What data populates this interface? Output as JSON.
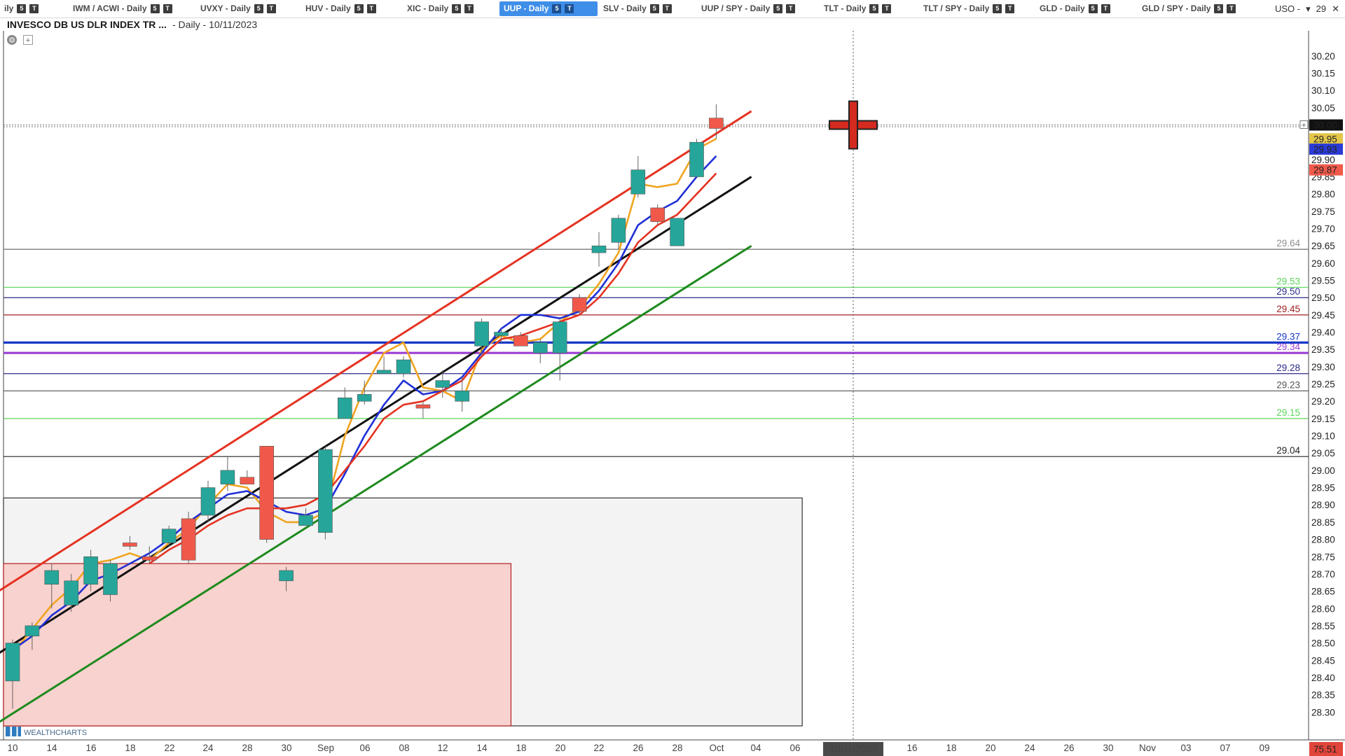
{
  "tabs": [
    {
      "label": "ily",
      "badges": [
        "5",
        "T"
      ],
      "active": false
    },
    {
      "label": "IWM / ACWI - Daily",
      "badges": [
        "5",
        "T"
      ],
      "active": false
    },
    {
      "label": "UVXY - Daily",
      "badges": [
        "5",
        "T"
      ],
      "active": false
    },
    {
      "label": "HUV - Daily",
      "badges": [
        "5",
        "T"
      ],
      "active": false
    },
    {
      "label": "XIC - Daily",
      "badges": [
        "5",
        "T"
      ],
      "active": false
    },
    {
      "label": "UUP - Daily",
      "badges": [
        "5",
        "T"
      ],
      "active": true
    },
    {
      "label": "SLV - Daily",
      "badges": [
        "5",
        "T"
      ],
      "active": false
    },
    {
      "label": "UUP / SPY - Daily",
      "badges": [
        "5",
        "T"
      ],
      "active": false
    },
    {
      "label": "TLT - Daily",
      "badges": [
        "5",
        "T"
      ],
      "active": false
    },
    {
      "label": "TLT / SPY - Daily",
      "badges": [
        "5",
        "T"
      ],
      "active": false
    },
    {
      "label": "GLD - Daily",
      "badges": [
        "5",
        "T"
      ],
      "active": false
    },
    {
      "label": "GLD / SPY - Daily",
      "badges": [
        "5",
        "T"
      ],
      "active": false
    }
  ],
  "tab_overflow": {
    "label": "USO -",
    "arrow": "▾",
    "count": "29",
    "close": "✕"
  },
  "header": {
    "title": "INVESCO DB US DLR INDEX TR ...",
    "subtitle": "- Daily - 10/11/2023"
  },
  "controls": {
    "settings_icon": "gear-icon",
    "add_icon": "plus-icon",
    "add_glyph": "+",
    "settings_glyph": "⚙"
  },
  "logo": {
    "text": "WEALTHCHARTS"
  },
  "colors": {
    "bull": "#26a69a",
    "bear": "#f0594a",
    "channel_upper": "#e53322",
    "channel_mid": "#111111",
    "channel_lower": "#1e8a1e",
    "ma_orange": "#f0a420",
    "ma_blue": "#1f2fd6",
    "ma_red": "#e53322"
  },
  "chart_data": {
    "type": "candlestick",
    "y_range": [
      28.26,
      30.22
    ],
    "y_ticks": [
      "30.20",
      "30.15",
      "30.10",
      "30.05",
      "29.90",
      "29.85",
      "29.80",
      "29.75",
      "29.70",
      "29.65",
      "29.60",
      "29.55",
      "29.50",
      "29.45",
      "29.40",
      "29.35",
      "29.30",
      "29.25",
      "29.20",
      "29.15",
      "29.10",
      "29.05",
      "29.00",
      "28.95",
      "28.90",
      "28.85",
      "28.80",
      "28.75",
      "28.70",
      "28.65",
      "28.60",
      "28.55",
      "28.50",
      "28.45",
      "28.40",
      "28.35",
      "28.30"
    ],
    "x_ticks": [
      "10",
      "14",
      "16",
      "18",
      "22",
      "24",
      "28",
      "30",
      "Sep",
      "06",
      "08",
      "12",
      "14",
      "18",
      "20",
      "22",
      "26",
      "28",
      "Oct",
      "04",
      "06",
      "10/11/2023",
      "16",
      "18",
      "20",
      "24",
      "26",
      "30",
      "Nov",
      "03",
      "07",
      "09"
    ],
    "candles": [
      {
        "o": 28.39,
        "h": 28.51,
        "l": 28.31,
        "c": 28.5
      },
      {
        "o": 28.52,
        "h": 28.56,
        "l": 28.48,
        "c": 28.55
      },
      {
        "o": 28.67,
        "h": 28.73,
        "l": 28.6,
        "c": 28.71
      },
      {
        "o": 28.61,
        "h": 28.7,
        "l": 28.59,
        "c": 28.68
      },
      {
        "o": 28.67,
        "h": 28.77,
        "l": 28.65,
        "c": 28.75
      },
      {
        "o": 28.64,
        "h": 28.74,
        "l": 28.62,
        "c": 28.73
      },
      {
        "o": 28.79,
        "h": 28.81,
        "l": 28.77,
        "c": 28.78
      },
      {
        "o": 28.75,
        "h": 28.78,
        "l": 28.73,
        "c": 28.74
      },
      {
        "o": 28.79,
        "h": 28.84,
        "l": 28.78,
        "c": 28.83
      },
      {
        "o": 28.86,
        "h": 28.88,
        "l": 28.73,
        "c": 28.74
      },
      {
        "o": 28.87,
        "h": 28.97,
        "l": 28.85,
        "c": 28.95
      },
      {
        "o": 28.96,
        "h": 29.04,
        "l": 28.94,
        "c": 29.0
      },
      {
        "o": 28.98,
        "h": 29.0,
        "l": 28.96,
        "c": 28.96
      },
      {
        "o": 29.07,
        "h": 29.07,
        "l": 28.79,
        "c": 28.8
      },
      {
        "o": 28.68,
        "h": 28.72,
        "l": 28.65,
        "c": 28.71
      },
      {
        "o": 28.84,
        "h": 28.89,
        "l": 28.84,
        "c": 28.87
      },
      {
        "o": 28.82,
        "h": 29.07,
        "l": 28.8,
        "c": 29.06
      },
      {
        "o": 29.15,
        "h": 29.24,
        "l": 29.15,
        "c": 29.21
      },
      {
        "o": 29.2,
        "h": 29.26,
        "l": 29.19,
        "c": 29.22
      },
      {
        "o": 29.28,
        "h": 29.33,
        "l": 29.28,
        "c": 29.29
      },
      {
        "o": 29.28,
        "h": 29.33,
        "l": 29.27,
        "c": 29.32
      },
      {
        "o": 29.19,
        "h": 29.2,
        "l": 29.15,
        "c": 29.18
      },
      {
        "o": 29.24,
        "h": 29.29,
        "l": 29.21,
        "c": 29.26
      },
      {
        "o": 29.2,
        "h": 29.27,
        "l": 29.17,
        "c": 29.23
      },
      {
        "o": 29.36,
        "h": 29.44,
        "l": 29.33,
        "c": 29.43
      },
      {
        "o": 29.39,
        "h": 29.41,
        "l": 29.37,
        "c": 29.4
      },
      {
        "o": 29.39,
        "h": 29.4,
        "l": 29.36,
        "c": 29.36
      },
      {
        "o": 29.34,
        "h": 29.38,
        "l": 29.31,
        "c": 29.37
      },
      {
        "o": 29.34,
        "h": 29.44,
        "l": 29.26,
        "c": 29.43
      },
      {
        "o": 29.5,
        "h": 29.51,
        "l": 29.45,
        "c": 29.46
      },
      {
        "o": 29.63,
        "h": 29.69,
        "l": 29.59,
        "c": 29.65
      },
      {
        "o": 29.66,
        "h": 29.74,
        "l": 29.64,
        "c": 29.73
      },
      {
        "o": 29.8,
        "h": 29.91,
        "l": 29.79,
        "c": 29.87
      },
      {
        "o": 29.76,
        "h": 29.77,
        "l": 29.71,
        "c": 29.72
      },
      {
        "o": 29.65,
        "h": 29.73,
        "l": 29.65,
        "c": 29.73
      },
      {
        "o": 29.85,
        "h": 29.96,
        "l": 29.85,
        "c": 29.95
      },
      {
        "o": 30.02,
        "h": 30.06,
        "l": 29.96,
        "c": 29.99
      }
    ],
    "price_lines": [
      {
        "value": 29.64,
        "label": "29.64",
        "color": "#8e8e8e",
        "width": 1.6
      },
      {
        "value": 29.53,
        "label": "29.53",
        "color": "#5cd65c",
        "width": 1.2
      },
      {
        "value": 29.5,
        "label": "29.50",
        "color": "#2a2a8a",
        "width": 1.2
      },
      {
        "value": 29.45,
        "label": "29.45",
        "color": "#a02020",
        "width": 1.2
      },
      {
        "value": 29.37,
        "label": "29.37",
        "color": "#1638c8",
        "width": 3.2
      },
      {
        "value": 29.34,
        "label": "29.34",
        "color": "#9b3fd4",
        "width": 3.2
      },
      {
        "value": 29.28,
        "label": "29.28",
        "color": "#2a2a8a",
        "width": 1.2
      },
      {
        "value": 29.23,
        "label": "29.23",
        "color": "#555555",
        "width": 1.2
      },
      {
        "value": 29.15,
        "label": "29.15",
        "color": "#5cd65c",
        "width": 1.2
      },
      {
        "value": 29.04,
        "label": "29.04",
        "color": "#222222",
        "width": 1.2
      }
    ],
    "axis_labels": [
      {
        "value": 30.0,
        "label": "30.00",
        "bg": "#111111",
        "fg": "#ffffff"
      },
      {
        "value": 29.96,
        "label": "29.95",
        "bg": "#e3c64a",
        "fg": "#ffffff"
      },
      {
        "value": 29.93,
        "label": "29.93",
        "bg": "#2b3bd6",
        "fg": "#ffffff"
      },
      {
        "value": 29.87,
        "label": "29.87",
        "bg": "#f05a4a",
        "fg": "#ffffff"
      }
    ],
    "bottom_badges": {
      "date": "10/11/2023",
      "price": "75.51"
    },
    "zones": [
      {
        "from_bar": -1,
        "to_bar": 40.4,
        "high": 28.92,
        "low": 28.26,
        "fill": "#f3f3f3",
        "stroke": "#333333"
      },
      {
        "from_bar": -1,
        "to_bar": 25.5,
        "high": 28.73,
        "low": 28.26,
        "fill": "#f8d2ce",
        "stroke": "#b22020"
      }
    ],
    "channel": [
      {
        "name": "upper",
        "b0": -1,
        "v0": 28.64,
        "b1": 37.8,
        "v1": 30.04,
        "color": "#e53322"
      },
      {
        "name": "middle",
        "b0": -1,
        "v0": 28.46,
        "b1": 37.8,
        "v1": 29.85,
        "color": "#111111"
      },
      {
        "name": "lower",
        "b0": -1,
        "v0": 28.26,
        "b1": 37.8,
        "v1": 29.65,
        "color": "#1e8a1e"
      }
    ],
    "moving_averages": [
      {
        "name": "orange",
        "color": "#f0a420",
        "values": [
          28.47,
          28.54,
          28.61,
          28.66,
          28.73,
          28.74,
          28.76,
          28.74,
          28.79,
          28.83,
          28.9,
          28.96,
          28.95,
          28.88,
          28.85,
          28.85,
          28.88,
          29.1,
          29.24,
          29.34,
          29.37,
          29.24,
          29.23,
          29.2,
          29.35,
          29.39,
          29.37,
          29.38,
          29.43,
          29.47,
          29.54,
          29.63,
          29.83,
          29.82,
          29.83,
          29.93,
          29.96
        ]
      },
      {
        "name": "blue",
        "color": "#1f2fd6",
        "values": [
          28.48,
          28.52,
          28.58,
          28.62,
          28.68,
          28.7,
          28.73,
          28.76,
          28.8,
          28.85,
          28.89,
          28.93,
          28.94,
          28.91,
          28.88,
          28.87,
          28.89,
          28.99,
          29.1,
          29.19,
          29.26,
          29.22,
          29.23,
          29.27,
          29.34,
          29.41,
          29.45,
          29.45,
          29.44,
          29.46,
          29.52,
          29.6,
          29.71,
          29.75,
          29.78,
          29.85,
          29.91
        ]
      },
      {
        "name": "red",
        "color": "#e53322",
        "values": [
          null,
          null,
          null,
          null,
          null,
          null,
          null,
          28.73,
          28.77,
          28.8,
          28.84,
          28.87,
          28.89,
          28.89,
          28.89,
          28.9,
          28.93,
          29.0,
          29.07,
          29.15,
          29.19,
          29.2,
          29.23,
          29.26,
          29.33,
          29.38,
          29.39,
          29.41,
          29.43,
          29.45,
          29.5,
          29.57,
          29.66,
          29.71,
          29.74,
          29.8,
          29.86
        ]
      }
    ]
  }
}
